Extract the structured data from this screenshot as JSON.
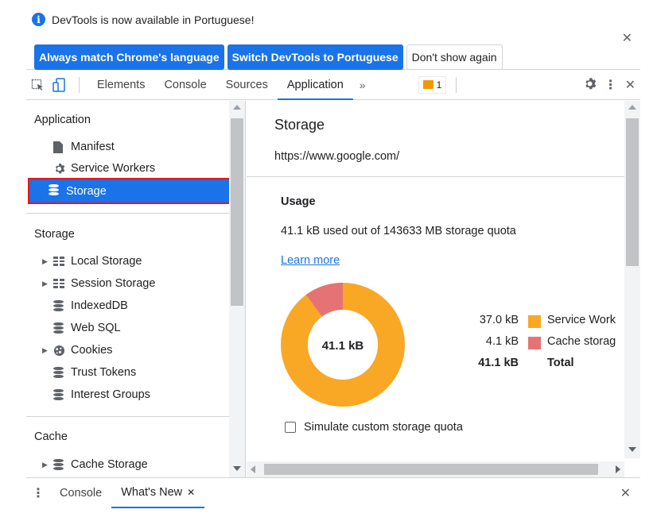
{
  "infobar": {
    "message": "DevTools is now available in Portuguese!",
    "info_icon": "i",
    "btn_match": "Always match Chrome's language",
    "btn_switch": "Switch DevTools to Portuguese",
    "btn_dont_show": "Don't show again",
    "close": "✕"
  },
  "tabbar": {
    "tabs": [
      "Elements",
      "Console",
      "Sources",
      "Application"
    ],
    "active_tab": "Application",
    "more": "»",
    "issues_count": "1",
    "settings_icon": "gear-icon",
    "menu_icon": "⋮",
    "close": "✕"
  },
  "sidebar": {
    "application_title": "Application",
    "application_items": [
      "Manifest",
      "Service Workers",
      "Storage"
    ],
    "selected": "Storage",
    "storage_title": "Storage",
    "storage_items": [
      "Local Storage",
      "Session Storage",
      "IndexedDB",
      "Web SQL",
      "Cookies",
      "Trust Tokens",
      "Interest Groups"
    ],
    "cache_title": "Cache",
    "cache_items": [
      "Cache Storage"
    ]
  },
  "main": {
    "title": "Storage",
    "origin": "https://www.google.com/",
    "usage_title": "Usage",
    "usage_text": "41.1 kB used out of 143633 MB storage quota",
    "learn_more": "Learn more",
    "donut_center": "41.1 kB",
    "legend": [
      {
        "value": "37.0 kB",
        "name": "Service Work",
        "color": "#f9a825"
      },
      {
        "value": "4.1 kB",
        "name": "Cache storag",
        "color": "#e57373"
      }
    ],
    "total_value": "41.1 kB",
    "total_label": "Total",
    "simulate_label": "Simulate custom storage quota"
  },
  "drawer": {
    "menu": "⋮",
    "tabs": [
      "Console",
      "What's New"
    ],
    "active": "What's New",
    "tab_close": "✕",
    "close": "✕"
  },
  "colors": {
    "accent": "#1a73e8",
    "selected_outline": "#e8141b",
    "service_workers": "#f9a825",
    "cache_storage": "#e57373"
  }
}
